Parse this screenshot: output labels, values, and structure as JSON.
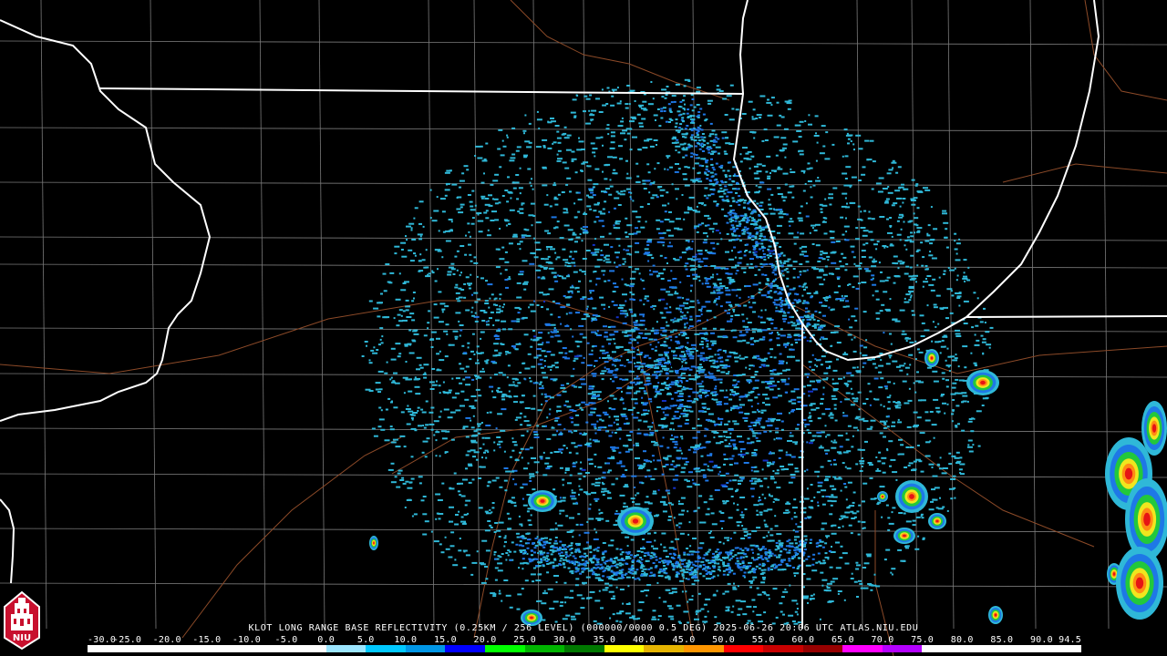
{
  "radar": {
    "title": "KLOT LONG RANGE BASE REFLECTIVITY (0.25KM / 256 LEVEL) (000000/0000 0.5 DEG) 2025-06-26 20:06 UTC  ATLAS.NIU.EDU",
    "scale_ticks": [
      "-30.0",
      "-25.0",
      "-20.0",
      "-15.0",
      "-10.0",
      "-5.0",
      "0.0",
      "5.0",
      "10.0",
      "15.0",
      "20.0",
      "25.0",
      "30.0",
      "35.0",
      "40.0",
      "45.0",
      "50.0",
      "55.0",
      "60.0",
      "65.0",
      "70.0",
      "75.0",
      "80.0",
      "85.0",
      "90.0",
      "94.5"
    ],
    "scale_colors": [
      "#ffffff",
      "#ffffff",
      "#ffffff",
      "#ffffff",
      "#ffffff",
      "#ffffff",
      "#9ce6ff",
      "#00c8ff",
      "#0096e6",
      "#0000ff",
      "#00ff00",
      "#00b400",
      "#007800",
      "#ffff00",
      "#e6b400",
      "#ff9600",
      "#ff0000",
      "#c80000",
      "#960000",
      "#ff00ff",
      "#b400ff",
      "#ffffff",
      "#ffffff",
      "#ffffff",
      "#ffffff"
    ],
    "colors": {
      "echo_light": "#2fb8d8",
      "echo_mid": "#1e78e6",
      "echo_deep": "#1432c8",
      "storm_green": "#22c83c",
      "storm_yellow": "#f0e61e",
      "storm_orange": "#ff8c14",
      "storm_red": "#e61414",
      "state_line": "#ffffff",
      "county_line": "#808080",
      "highway": "#8c4a28"
    }
  },
  "logo": {
    "text": "NIU",
    "icon": "university-tower-icon"
  }
}
